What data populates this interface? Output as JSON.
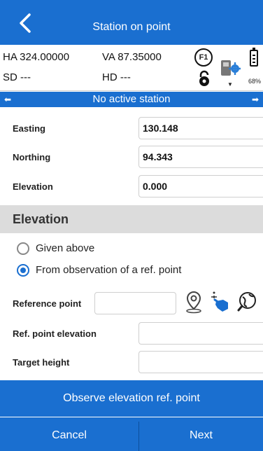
{
  "header": {
    "title": "Station on point",
    "back_icon": "back-arrow-icon"
  },
  "status": {
    "ha": "HA 324.00000",
    "va": "VA 87.35000",
    "sd": "SD ---",
    "hd": "HD ---",
    "f1": "F1",
    "battery_pct": "68%",
    "icons": [
      "f1-key-icon",
      "lock-icon",
      "instrument-settings-icon",
      "battery-icon"
    ]
  },
  "station_banner": "No active station",
  "coords": [
    {
      "label": "Easting",
      "value": "130.148"
    },
    {
      "label": "Northing",
      "value": "94.343"
    },
    {
      "label": "Elevation",
      "value": "0.000"
    }
  ],
  "elevation_section": {
    "title": "Elevation",
    "options": [
      {
        "label": "Given above",
        "selected": false
      },
      {
        "label": "From observation of a ref. point",
        "selected": true
      }
    ],
    "reference_point_label": "Reference point",
    "reference_point_value": "",
    "ref_elevation_label": "Ref. point elevation",
    "ref_elevation_value": "",
    "target_height_label": "Target height",
    "target_height_value": "",
    "icons": [
      "map-pin-icon",
      "point-select-icon",
      "globe-search-icon"
    ]
  },
  "actions": {
    "observe_label": "Observe elevation ref. point",
    "cancel_label": "Cancel",
    "next_label": "Next"
  },
  "colors": {
    "accent": "#1a6fd0",
    "section_bg": "#dcdcdc"
  }
}
